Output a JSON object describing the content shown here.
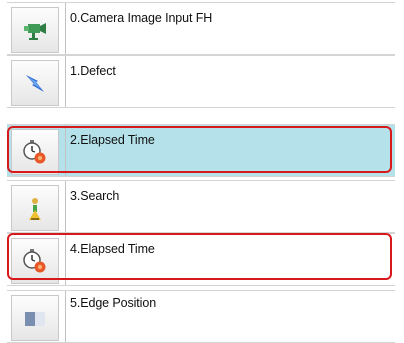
{
  "flow": {
    "items": [
      {
        "label": "0.Camera Image Input FH",
        "icon": "camera-icon",
        "selected": false,
        "highlighted": false
      },
      {
        "label": "1.Defect",
        "icon": "defect-icon",
        "selected": false,
        "highlighted": false
      },
      {
        "label": "2.Elapsed Time",
        "icon": "stopwatch-icon",
        "selected": true,
        "highlighted": true
      },
      {
        "label": "3.Search",
        "icon": "search-figure-icon",
        "selected": false,
        "highlighted": false
      },
      {
        "label": "4.Elapsed Time",
        "icon": "stopwatch-icon",
        "selected": false,
        "highlighted": true
      },
      {
        "label": "5.Edge Position",
        "icon": "edge-position-icon",
        "selected": false,
        "highlighted": false
      }
    ]
  },
  "colors": {
    "selected_bg": "#b5e2ea",
    "highlight_border": "#d7191c",
    "row_border": "#d4d4d4"
  }
}
